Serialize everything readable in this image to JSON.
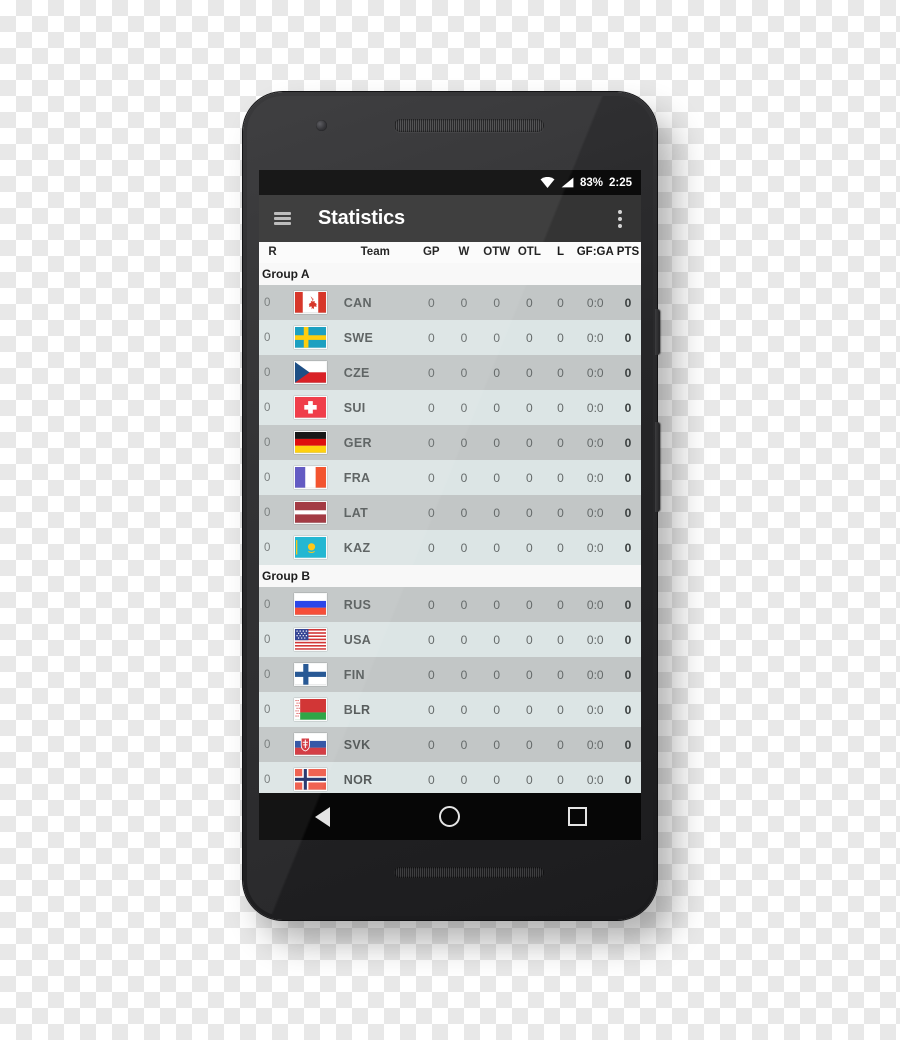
{
  "status_bar": {
    "wifi_icon": "wifi-icon",
    "signal_icon": "signal-icon",
    "battery": "83%",
    "clock": "2:25"
  },
  "app_bar": {
    "menu_icon": "hamburger-menu-icon",
    "title": "Statistics",
    "overflow_icon": "overflow-menu-icon"
  },
  "table": {
    "headers": {
      "rank": "R",
      "flag": "",
      "team": "Team",
      "gp": "GP",
      "w": "W",
      "otw": "OTW",
      "otl": "OTL",
      "l": "L",
      "gfga": "GF:GA",
      "pts": "PTS"
    },
    "groups": [
      {
        "label": "Group A",
        "rows": [
          {
            "rank": "0",
            "code": "CAN",
            "flag": "canada-flag",
            "gp": "0",
            "w": "0",
            "otw": "0",
            "otl": "0",
            "l": "0",
            "gfga": "0:0",
            "pts": "0"
          },
          {
            "rank": "0",
            "code": "SWE",
            "flag": "sweden-flag",
            "gp": "0",
            "w": "0",
            "otw": "0",
            "otl": "0",
            "l": "0",
            "gfga": "0:0",
            "pts": "0"
          },
          {
            "rank": "0",
            "code": "CZE",
            "flag": "czech-flag",
            "gp": "0",
            "w": "0",
            "otw": "0",
            "otl": "0",
            "l": "0",
            "gfga": "0:0",
            "pts": "0"
          },
          {
            "rank": "0",
            "code": "SUI",
            "flag": "switzerland-flag",
            "gp": "0",
            "w": "0",
            "otw": "0",
            "otl": "0",
            "l": "0",
            "gfga": "0:0",
            "pts": "0"
          },
          {
            "rank": "0",
            "code": "GER",
            "flag": "germany-flag",
            "gp": "0",
            "w": "0",
            "otw": "0",
            "otl": "0",
            "l": "0",
            "gfga": "0:0",
            "pts": "0"
          },
          {
            "rank": "0",
            "code": "FRA",
            "flag": "france-flag",
            "gp": "0",
            "w": "0",
            "otw": "0",
            "otl": "0",
            "l": "0",
            "gfga": "0:0",
            "pts": "0"
          },
          {
            "rank": "0",
            "code": "LAT",
            "flag": "latvia-flag",
            "gp": "0",
            "w": "0",
            "otw": "0",
            "otl": "0",
            "l": "0",
            "gfga": "0:0",
            "pts": "0"
          },
          {
            "rank": "0",
            "code": "KAZ",
            "flag": "kazakhstan-flag",
            "gp": "0",
            "w": "0",
            "otw": "0",
            "otl": "0",
            "l": "0",
            "gfga": "0:0",
            "pts": "0"
          }
        ]
      },
      {
        "label": "Group B",
        "rows": [
          {
            "rank": "0",
            "code": "RUS",
            "flag": "russia-flag",
            "gp": "0",
            "w": "0",
            "otw": "0",
            "otl": "0",
            "l": "0",
            "gfga": "0:0",
            "pts": "0"
          },
          {
            "rank": "0",
            "code": "USA",
            "flag": "usa-flag",
            "gp": "0",
            "w": "0",
            "otw": "0",
            "otl": "0",
            "l": "0",
            "gfga": "0:0",
            "pts": "0"
          },
          {
            "rank": "0",
            "code": "FIN",
            "flag": "finland-flag",
            "gp": "0",
            "w": "0",
            "otw": "0",
            "otl": "0",
            "l": "0",
            "gfga": "0:0",
            "pts": "0"
          },
          {
            "rank": "0",
            "code": "BLR",
            "flag": "belarus-flag",
            "gp": "0",
            "w": "0",
            "otw": "0",
            "otl": "0",
            "l": "0",
            "gfga": "0:0",
            "pts": "0"
          },
          {
            "rank": "0",
            "code": "SVK",
            "flag": "slovakia-flag",
            "gp": "0",
            "w": "0",
            "otw": "0",
            "otl": "0",
            "l": "0",
            "gfga": "0:0",
            "pts": "0"
          },
          {
            "rank": "0",
            "code": "NOR",
            "flag": "norway-flag",
            "gp": "0",
            "w": "0",
            "otw": "0",
            "otl": "0",
            "l": "0",
            "gfga": "0:0",
            "pts": "0"
          }
        ]
      }
    ]
  },
  "nav_bar": {
    "back": "back-triangle-icon",
    "home": "home-circle-icon",
    "recents": "recents-square-icon"
  },
  "colors": {
    "app_bar": "#343434",
    "status_bar": "#0b0b0b",
    "row_odd": "#c2c6c6",
    "row_even": "#dce5e5",
    "group_header": "#f8f8f8"
  }
}
